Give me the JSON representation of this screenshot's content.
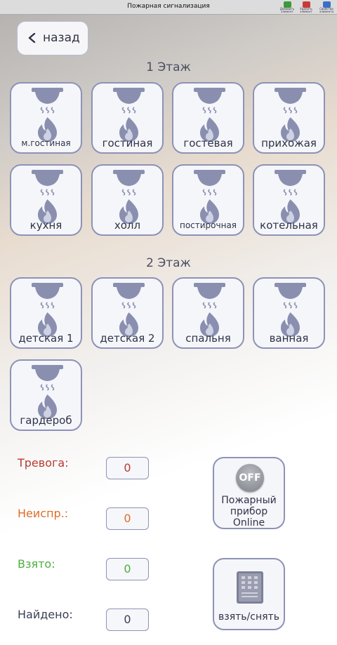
{
  "window": {
    "title": "Пожарная сигнализация",
    "buttons": [
      {
        "label": "Добавить\nэлемент",
        "color": "#3a9a3a"
      },
      {
        "label": "Удалить\nэлемент",
        "color": "#c83a3a"
      },
      {
        "label": "Свойства\nэлемента",
        "color": "#3a6ec8"
      }
    ]
  },
  "nav": {
    "back_label": "назад"
  },
  "floors": [
    {
      "title": "1 Этаж",
      "rooms": [
        "м.гостиная",
        "гостиная",
        "гостевая",
        "прихожая",
        "кухня",
        "холл",
        "постирочная",
        "котельная"
      ]
    },
    {
      "title": "2 Этаж",
      "rooms": [
        "детская 1",
        "детская 2",
        "спальня",
        "ванная",
        "гардероб"
      ]
    }
  ],
  "stats": [
    {
      "label": "Тревога:",
      "value": "0",
      "color": "#b83a32"
    },
    {
      "label": "Неиспр.:",
      "value": "0",
      "color": "#e06c28"
    },
    {
      "label": "Взято:",
      "value": "0",
      "color": "#4caf3e"
    },
    {
      "label": "Найдено:",
      "value": "0",
      "color": "#3a3f55"
    }
  ],
  "device": {
    "badge": "OFF",
    "line1": "Пожарный",
    "line2": "прибор",
    "line3": "Online"
  },
  "arm": {
    "label": "взять/снять"
  },
  "colors": {
    "tile_border": "#8d92b6",
    "icon": "#8a8fb0",
    "text": "#2f3347"
  }
}
